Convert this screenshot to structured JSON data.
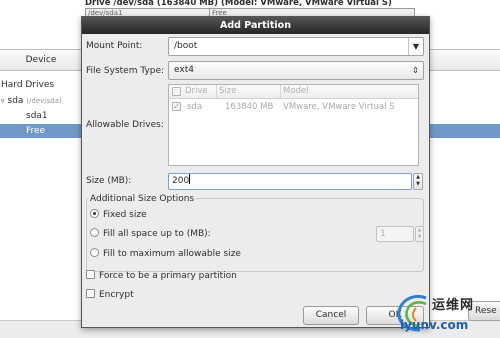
{
  "background": {
    "drive_header": "Drive /dev/sda (163840 MB) (Model: VMware, VMware Virtual S)",
    "graph_segments": [
      "/dev/sda1",
      "Free"
    ],
    "tree_header": "Device",
    "tree": {
      "hard_drives": "Hard Drives",
      "sda": "sda",
      "sda_path": "(/dev/sda)",
      "sda1": "sda1",
      "free": "Free"
    },
    "reset_label": "Rese"
  },
  "dialog": {
    "title": "Add Partition",
    "mount_point_label": "Mount Point:",
    "mount_point_value": "/boot",
    "fs_type_label": "File System Type:",
    "fs_type_value": "ext4",
    "allowable_drives_label": "Allowable Drives:",
    "drives_columns": [
      "Drive",
      "Size",
      "Model"
    ],
    "drives_rows": [
      {
        "drive": "sda",
        "size": "163840 MB",
        "model": "VMware, VMware Virtual S",
        "checked": true
      }
    ],
    "size_label": "Size (MB):",
    "size_value": "200",
    "additional_options_label": "Additional Size Options",
    "options": {
      "fixed": "Fixed size",
      "fill_upto": "Fill all space up to (MB):",
      "fill_upto_value": "1",
      "fill_max": "Fill to maximum allowable size"
    },
    "selected_option": "fixed",
    "primary_label": "Force to be a primary partition",
    "encrypt_label": "Encrypt",
    "cancel_label": "Cancel",
    "ok_label": "OK"
  },
  "watermark": {
    "cn_text": "运维网",
    "url_text": "iyunv.com"
  },
  "colors": {
    "selection": "#6f98c9",
    "titlebar": "#2f2f2f",
    "dialog_bg": "#ececec",
    "watermark_blue": "#1f5fb0"
  }
}
